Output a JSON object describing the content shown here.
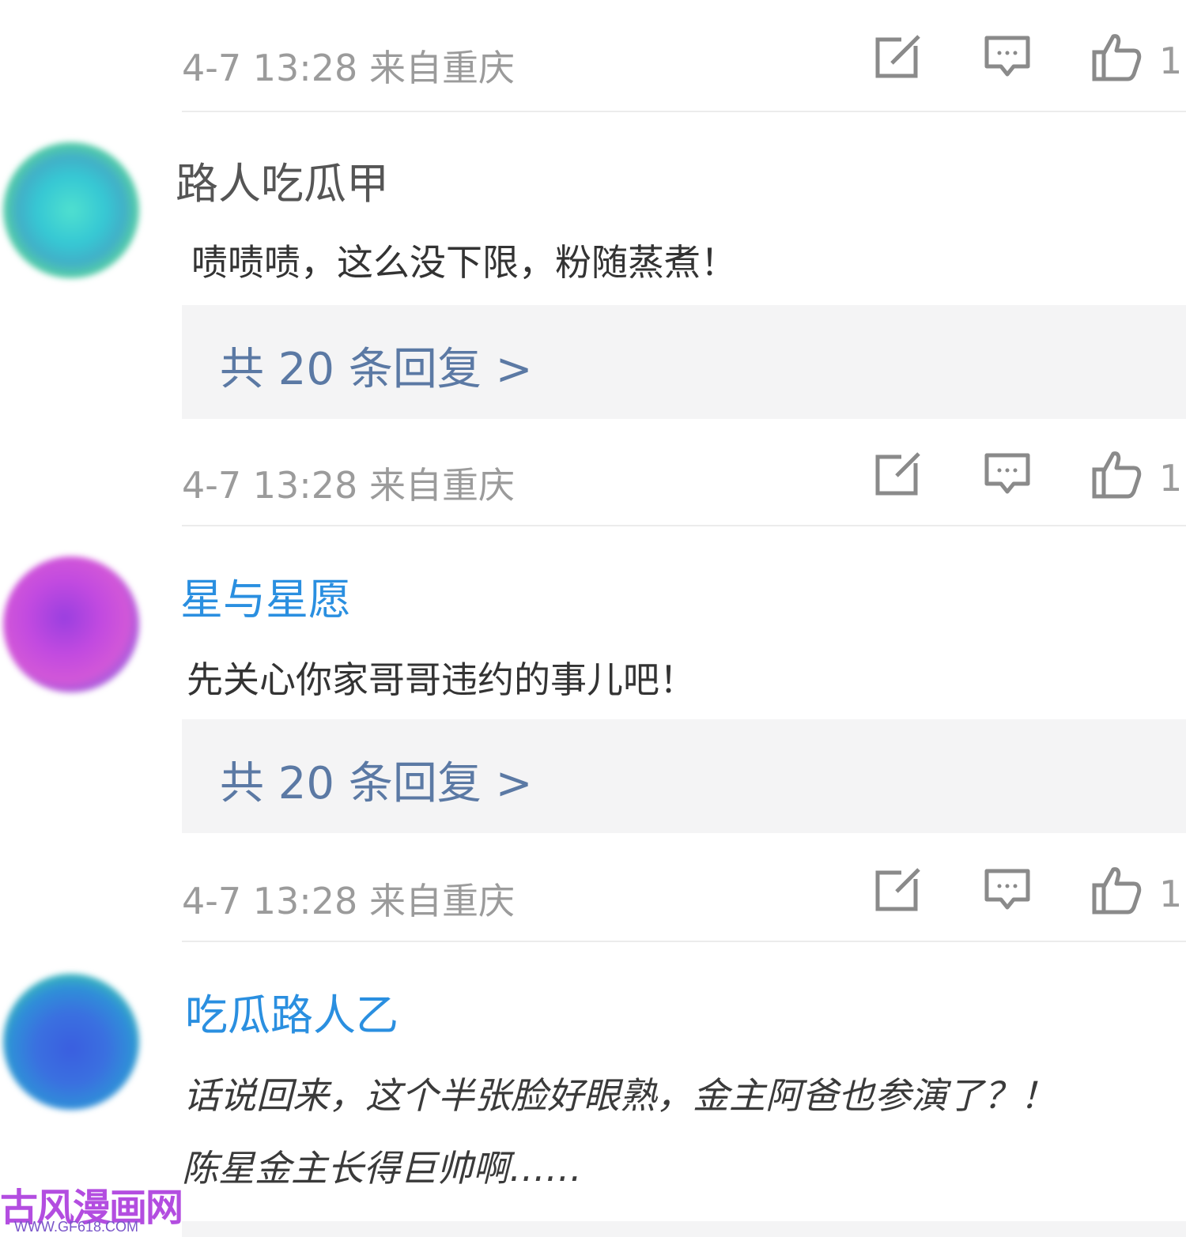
{
  "top_meta": {
    "time_location": "4-7 13:28 来自重庆",
    "like_count": "1:"
  },
  "comments": [
    {
      "username": "路人吃瓜甲",
      "username_color": "#555555",
      "text": "啧啧啧，这么没下限，粉随蒸煮！",
      "replies_label": "共 20 条回复 >",
      "time_location": "4-7 13:28 来自重庆",
      "like_count": "1:",
      "avatar_colors": [
        "#36d6c8",
        "#3fb8d9",
        "#e4456e",
        "#55d88a"
      ]
    },
    {
      "username": "星与星愿",
      "username_color": "#2a8fe0",
      "text": "先关心你家哥哥违约的事儿吧！",
      "replies_label": "共 20 条回复 >",
      "time_location": "4-7 13:28 来自重庆",
      "like_count": "1:",
      "avatar_colors": [
        "#c447e0",
        "#8a3fd0",
        "#5fcf7a",
        "#e060c0"
      ]
    },
    {
      "username": "吃瓜路人乙",
      "username_color": "#2a8fe0",
      "text_line1": "话说回来，这个半张脸好眼熟，金主阿爸也参演了？！",
      "text_line2": "陈星金主长得巨帅啊……",
      "avatar_colors": [
        "#3a6ee0",
        "#2f9fd8",
        "#e0903a",
        "#3fc9b0"
      ]
    }
  ],
  "icons": {
    "share": "share-edit-icon",
    "comment": "comment-bubble-icon",
    "like": "thumbs-up-icon"
  },
  "watermark": {
    "title": "古风漫画网",
    "url": "WWW.GF618.COM"
  }
}
